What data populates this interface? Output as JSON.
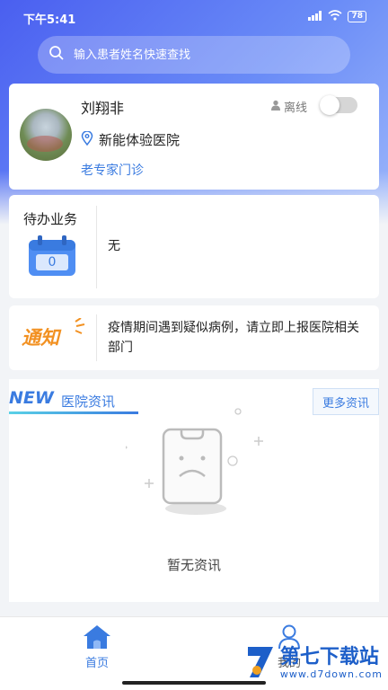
{
  "status_bar": {
    "time": "下午5:41",
    "battery": "78"
  },
  "search": {
    "placeholder": "输入患者姓名快速查找"
  },
  "profile": {
    "name": "刘翔非",
    "status": "离线",
    "hospital": "新能体验医院",
    "clinic": "老专家门诊",
    "online_toggle": false
  },
  "todo": {
    "title": "待办业务",
    "count": "0",
    "content": "无"
  },
  "notice": {
    "logo_text": "通知",
    "text": "疫情期间遇到疑似病例，请立即上报医院相关部门"
  },
  "news": {
    "badge": "NEW",
    "label": "医院资讯",
    "more": "更多资讯",
    "empty": "暂无资讯"
  },
  "tabbar": {
    "home": "首页",
    "me": "我的"
  },
  "watermark": {
    "title": "第七下载站",
    "url": "www.d7down.com"
  },
  "colors": {
    "accent": "#3a7be0",
    "header_start": "#4a5ff0",
    "header_end": "#9db7fb",
    "notice": "#f29122"
  }
}
